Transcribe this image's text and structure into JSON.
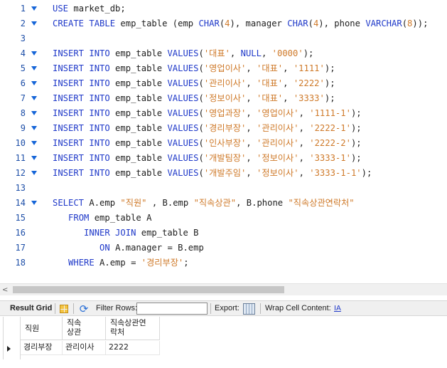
{
  "editor": {
    "lines": [
      {
        "n": "1",
        "fold": true,
        "tokens": [
          {
            "t": "USE",
            "c": "kw"
          },
          {
            "t": " market_db;",
            "c": ""
          }
        ]
      },
      {
        "n": "2",
        "fold": true,
        "tokens": [
          {
            "t": "CREATE TABLE",
            "c": "kw"
          },
          {
            "t": " emp_table (emp ",
            "c": ""
          },
          {
            "t": "CHAR",
            "c": "kw"
          },
          {
            "t": "(",
            "c": ""
          },
          {
            "t": "4",
            "c": "num"
          },
          {
            "t": "), manager ",
            "c": ""
          },
          {
            "t": "CHAR",
            "c": "kw"
          },
          {
            "t": "(",
            "c": ""
          },
          {
            "t": "4",
            "c": "num"
          },
          {
            "t": "), phone ",
            "c": ""
          },
          {
            "t": "VARCHAR",
            "c": "kw"
          },
          {
            "t": "(",
            "c": ""
          },
          {
            "t": "8",
            "c": "num"
          },
          {
            "t": "));",
            "c": ""
          }
        ]
      },
      {
        "n": "3",
        "fold": false,
        "tokens": []
      },
      {
        "n": "4",
        "fold": true,
        "tokens": [
          {
            "t": "INSERT INTO",
            "c": "kw"
          },
          {
            "t": " emp_table ",
            "c": ""
          },
          {
            "t": "VALUES",
            "c": "kw"
          },
          {
            "t": "(",
            "c": ""
          },
          {
            "t": "'대표'",
            "c": "str"
          },
          {
            "t": ", ",
            "c": ""
          },
          {
            "t": "NULL",
            "c": "kw"
          },
          {
            "t": ", ",
            "c": ""
          },
          {
            "t": "'0000'",
            "c": "str"
          },
          {
            "t": ");",
            "c": ""
          }
        ]
      },
      {
        "n": "5",
        "fold": true,
        "tokens": [
          {
            "t": "INSERT INTO",
            "c": "kw"
          },
          {
            "t": " emp_table ",
            "c": ""
          },
          {
            "t": "VALUES",
            "c": "kw"
          },
          {
            "t": "(",
            "c": ""
          },
          {
            "t": "'영업이사'",
            "c": "str"
          },
          {
            "t": ", ",
            "c": ""
          },
          {
            "t": "'대표'",
            "c": "str"
          },
          {
            "t": ", ",
            "c": ""
          },
          {
            "t": "'1111'",
            "c": "str"
          },
          {
            "t": ");",
            "c": ""
          }
        ]
      },
      {
        "n": "6",
        "fold": true,
        "tokens": [
          {
            "t": "INSERT INTO",
            "c": "kw"
          },
          {
            "t": " emp_table ",
            "c": ""
          },
          {
            "t": "VALUES",
            "c": "kw"
          },
          {
            "t": "(",
            "c": ""
          },
          {
            "t": "'관리이사'",
            "c": "str"
          },
          {
            "t": ", ",
            "c": ""
          },
          {
            "t": "'대표'",
            "c": "str"
          },
          {
            "t": ", ",
            "c": ""
          },
          {
            "t": "'2222'",
            "c": "str"
          },
          {
            "t": ");",
            "c": ""
          }
        ]
      },
      {
        "n": "7",
        "fold": true,
        "tokens": [
          {
            "t": "INSERT INTO",
            "c": "kw"
          },
          {
            "t": " emp_table ",
            "c": ""
          },
          {
            "t": "VALUES",
            "c": "kw"
          },
          {
            "t": "(",
            "c": ""
          },
          {
            "t": "'정보이사'",
            "c": "str"
          },
          {
            "t": ", ",
            "c": ""
          },
          {
            "t": "'대표'",
            "c": "str"
          },
          {
            "t": ", ",
            "c": ""
          },
          {
            "t": "'3333'",
            "c": "str"
          },
          {
            "t": ");",
            "c": ""
          }
        ]
      },
      {
        "n": "8",
        "fold": true,
        "tokens": [
          {
            "t": "INSERT INTO",
            "c": "kw"
          },
          {
            "t": " emp_table ",
            "c": ""
          },
          {
            "t": "VALUES",
            "c": "kw"
          },
          {
            "t": "(",
            "c": ""
          },
          {
            "t": "'영업과장'",
            "c": "str"
          },
          {
            "t": ", ",
            "c": ""
          },
          {
            "t": "'영업이사'",
            "c": "str"
          },
          {
            "t": ", ",
            "c": ""
          },
          {
            "t": "'1111-1'",
            "c": "str"
          },
          {
            "t": ");",
            "c": ""
          }
        ]
      },
      {
        "n": "9",
        "fold": true,
        "tokens": [
          {
            "t": "INSERT INTO",
            "c": "kw"
          },
          {
            "t": " emp_table ",
            "c": ""
          },
          {
            "t": "VALUES",
            "c": "kw"
          },
          {
            "t": "(",
            "c": ""
          },
          {
            "t": "'경리부장'",
            "c": "str"
          },
          {
            "t": ", ",
            "c": ""
          },
          {
            "t": "'관리이사'",
            "c": "str"
          },
          {
            "t": ", ",
            "c": ""
          },
          {
            "t": "'2222-1'",
            "c": "str"
          },
          {
            "t": ");",
            "c": ""
          }
        ]
      },
      {
        "n": "10",
        "fold": true,
        "tokens": [
          {
            "t": "INSERT INTO",
            "c": "kw"
          },
          {
            "t": " emp_table ",
            "c": ""
          },
          {
            "t": "VALUES",
            "c": "kw"
          },
          {
            "t": "(",
            "c": ""
          },
          {
            "t": "'인사부장'",
            "c": "str"
          },
          {
            "t": ", ",
            "c": ""
          },
          {
            "t": "'관리이사'",
            "c": "str"
          },
          {
            "t": ", ",
            "c": ""
          },
          {
            "t": "'2222-2'",
            "c": "str"
          },
          {
            "t": ");",
            "c": ""
          }
        ]
      },
      {
        "n": "11",
        "fold": true,
        "tokens": [
          {
            "t": "INSERT INTO",
            "c": "kw"
          },
          {
            "t": " emp_table ",
            "c": ""
          },
          {
            "t": "VALUES",
            "c": "kw"
          },
          {
            "t": "(",
            "c": ""
          },
          {
            "t": "'개발팀장'",
            "c": "str"
          },
          {
            "t": ", ",
            "c": ""
          },
          {
            "t": "'정보이사'",
            "c": "str"
          },
          {
            "t": ", ",
            "c": ""
          },
          {
            "t": "'3333-1'",
            "c": "str"
          },
          {
            "t": ");",
            "c": ""
          }
        ]
      },
      {
        "n": "12",
        "fold": true,
        "tokens": [
          {
            "t": "INSERT INTO",
            "c": "kw"
          },
          {
            "t": " emp_table ",
            "c": ""
          },
          {
            "t": "VALUES",
            "c": "kw"
          },
          {
            "t": "(",
            "c": ""
          },
          {
            "t": "'개발주임'",
            "c": "str"
          },
          {
            "t": ", ",
            "c": ""
          },
          {
            "t": "'정보이사'",
            "c": "str"
          },
          {
            "t": ", ",
            "c": ""
          },
          {
            "t": "'3333-1-1'",
            "c": "str"
          },
          {
            "t": ");",
            "c": ""
          }
        ]
      },
      {
        "n": "13",
        "fold": false,
        "tokens": []
      },
      {
        "n": "14",
        "fold": true,
        "tokens": [
          {
            "t": "SELECT",
            "c": "kw"
          },
          {
            "t": " A.emp ",
            "c": ""
          },
          {
            "t": "\"직원\"",
            "c": "str"
          },
          {
            "t": " , B.emp ",
            "c": ""
          },
          {
            "t": "\"직속상관\"",
            "c": "str"
          },
          {
            "t": ", B.phone ",
            "c": ""
          },
          {
            "t": "\"직속상관연락처\"",
            "c": "str"
          }
        ]
      },
      {
        "n": "15",
        "fold": false,
        "tokens": [
          {
            "t": "   ",
            "c": ""
          },
          {
            "t": "FROM",
            "c": "kw"
          },
          {
            "t": " emp_table A",
            "c": ""
          }
        ]
      },
      {
        "n": "16",
        "fold": false,
        "tokens": [
          {
            "t": "      ",
            "c": ""
          },
          {
            "t": "INNER JOIN",
            "c": "kw"
          },
          {
            "t": " emp_table B",
            "c": ""
          }
        ]
      },
      {
        "n": "17",
        "fold": false,
        "tokens": [
          {
            "t": "         ",
            "c": ""
          },
          {
            "t": "ON",
            "c": "kw"
          },
          {
            "t": " A.manager = B.emp",
            "c": ""
          }
        ]
      },
      {
        "n": "18",
        "fold": false,
        "tokens": [
          {
            "t": "   ",
            "c": ""
          },
          {
            "t": "WHERE",
            "c": "kw"
          },
          {
            "t": " A.emp = ",
            "c": ""
          },
          {
            "t": "'경리부장'",
            "c": "str"
          },
          {
            "t": ";",
            "c": ""
          }
        ]
      }
    ]
  },
  "scrollbar": {
    "left_arrow": "<"
  },
  "toolbar": {
    "result_grid": "Result Grid",
    "filter_rows": "Filter Rows:",
    "filter_value": "",
    "export": "Export:",
    "wrap_cell": "Wrap Cell Content:",
    "wrap_icon": "IA"
  },
  "result": {
    "headers": [
      "직원",
      "직속\n상관",
      "직속상관연\n락처"
    ],
    "rows": [
      [
        "경리부장",
        "관리이사",
        "2222"
      ]
    ]
  },
  "colors": {
    "keyword": "#1f39c9",
    "string": "#cf7a2a",
    "line_number": "#1e4fa8"
  }
}
